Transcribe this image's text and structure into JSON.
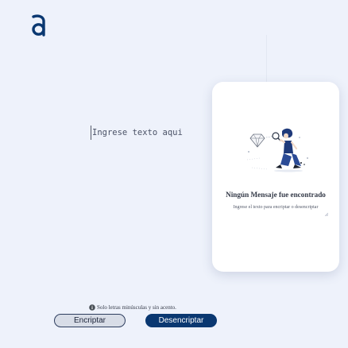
{
  "logo": {
    "name": "alura-logo-icon",
    "color": "#0a3871"
  },
  "input": {
    "placeholder": "Ingrese texto aqui",
    "value": ""
  },
  "card": {
    "title": "Ningún Mensaje fue encontrado",
    "subtitle": "Ingrese el texto para encriptar o desencriptar"
  },
  "hint": {
    "icon": "info-icon",
    "text": "Solo letras minúsculas y sin acento."
  },
  "buttons": {
    "encrypt": "Encriptar",
    "decrypt": "Desencriptar"
  },
  "colors": {
    "background": "#eef2fb",
    "accent": "#0a3871",
    "card": "#ffffff"
  }
}
